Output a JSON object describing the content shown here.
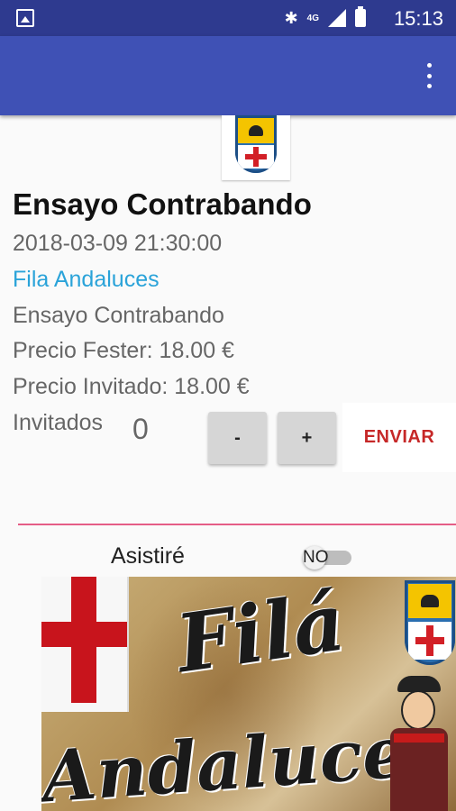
{
  "status_bar": {
    "time": "15:13",
    "network": "4G",
    "icons": [
      "image-icon",
      "bluetooth-icon",
      "signal-icon",
      "battery-icon"
    ]
  },
  "app_bar": {
    "menu_icon": "overflow-menu-icon",
    "color": "#3f51b5"
  },
  "event": {
    "title": "Ensayo Contrabando",
    "datetime": "2018-03-09 21:30:00",
    "fila": "Fila Andaluces",
    "description": "Ensayo Contrabando",
    "precio_fester": "Precio Fester: 18.00 €",
    "precio_invitado": "Precio Invitado: 18.00 €"
  },
  "invitados": {
    "label": "Invitados",
    "count": "0",
    "minus_label": "-",
    "plus_label": "+",
    "send_label": "ENVIAR"
  },
  "attendance": {
    "label": "Asistiré",
    "switch_text": "NO",
    "switch_on": false
  },
  "banner": {
    "line1": "Filá",
    "line2": "Andaluces"
  },
  "colors": {
    "primary": "#3f51b5",
    "status_bar": "#2e3a8f",
    "link": "#2aa3d9",
    "accent_divider": "#e55d86",
    "send_text": "#c62828"
  }
}
